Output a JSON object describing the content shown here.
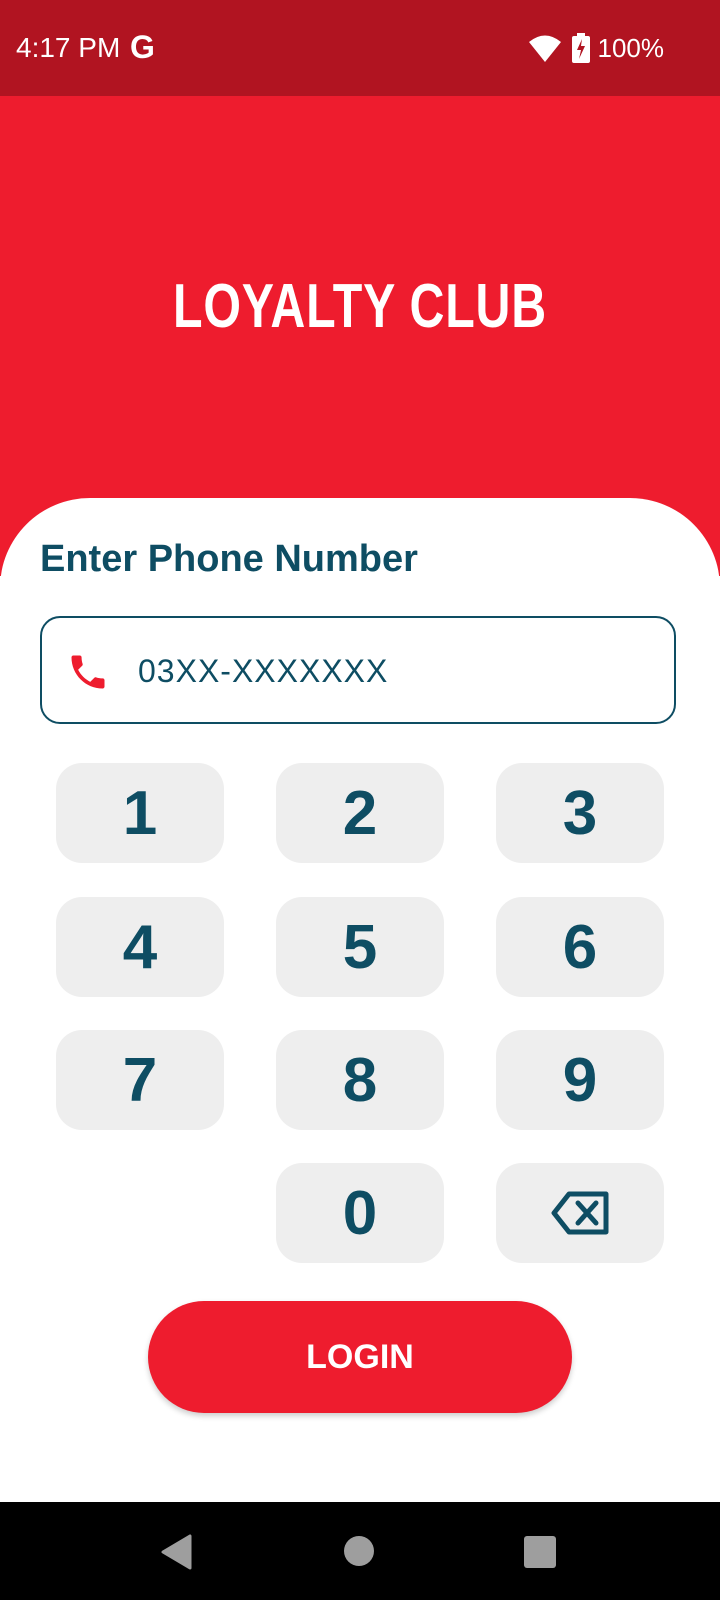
{
  "status_bar": {
    "time": "4:17 PM",
    "g_label": "G",
    "battery_percent": "100%",
    "wifi_badge": "4",
    "icons": [
      "google-icon",
      "wifi-icon",
      "battery-charging-icon"
    ]
  },
  "header": {
    "title": "LOYALTY CLUB"
  },
  "login_form": {
    "label": "Enter Phone Number",
    "phone_placeholder": "03XX-XXXXXXX",
    "phone_value": "",
    "phone_icon": "phone-icon"
  },
  "keypad": {
    "keys": [
      "1",
      "2",
      "3",
      "4",
      "5",
      "6",
      "7",
      "8",
      "9",
      "0"
    ],
    "backspace_icon": "backspace-icon"
  },
  "login_button": {
    "label": "LOGIN"
  },
  "nav_bar": {
    "icons": [
      "back-icon",
      "home-icon",
      "recents-icon"
    ]
  },
  "colors": {
    "status_bar": "#b11421",
    "brand_red": "#ee1c2e",
    "text_dark_teal": "#0e4d63",
    "key_background": "#eeeeee"
  }
}
